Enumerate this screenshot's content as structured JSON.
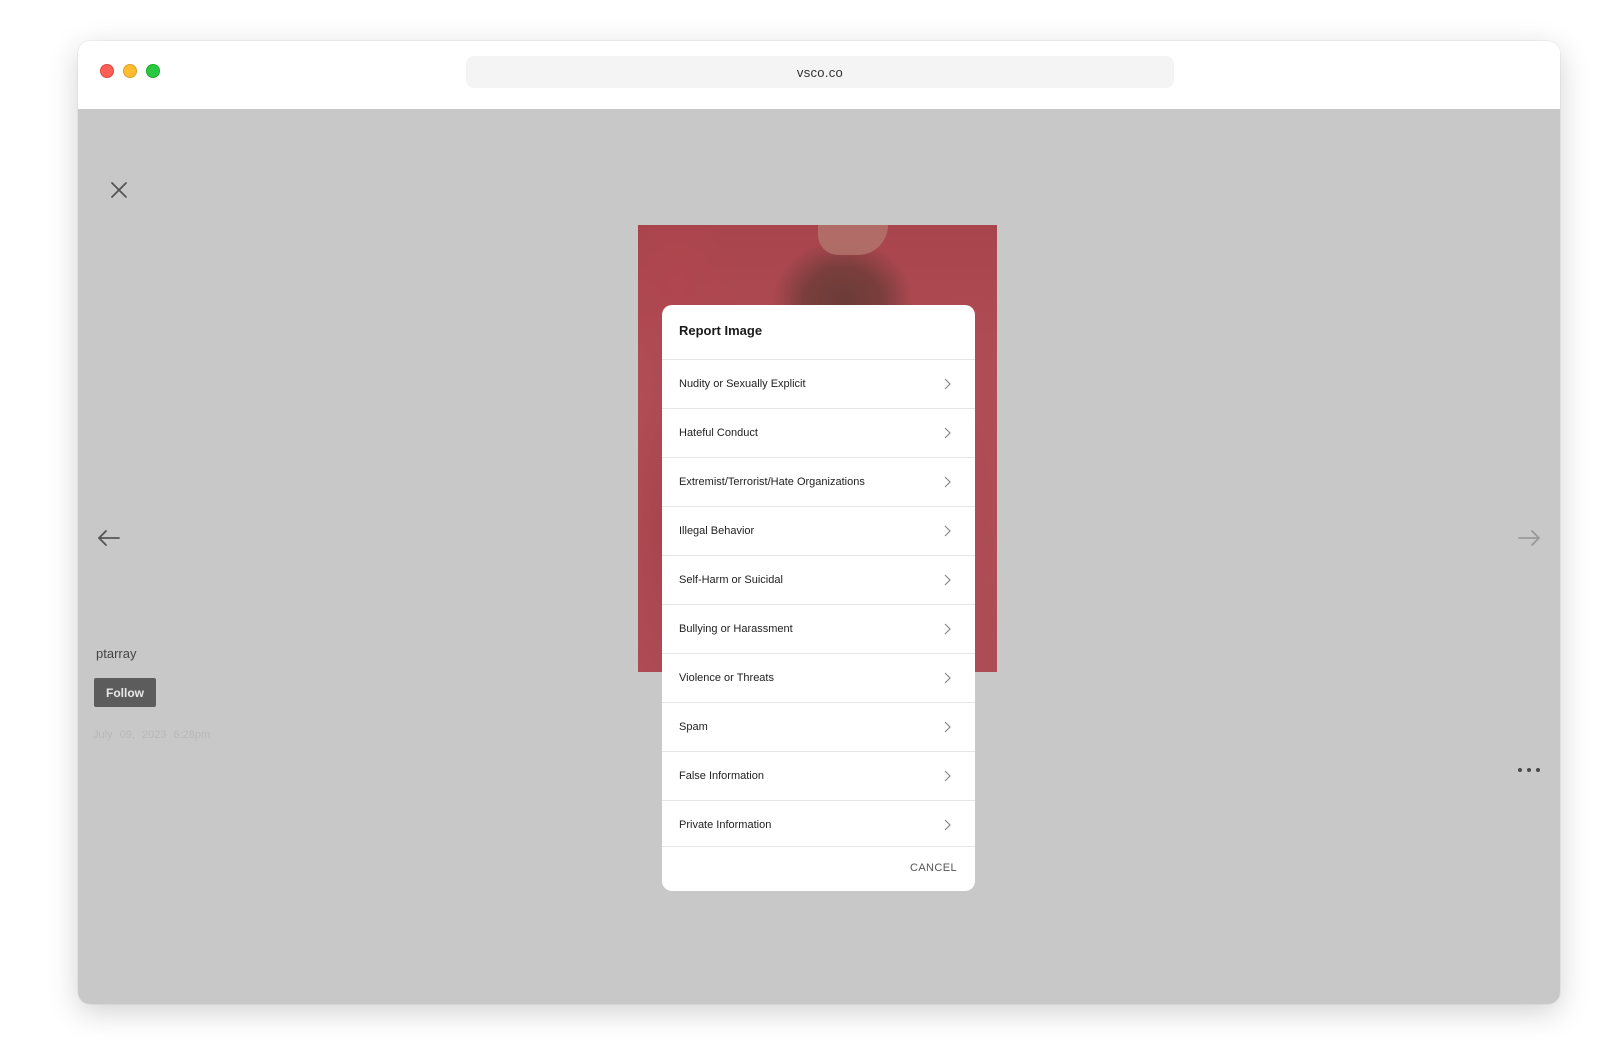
{
  "browser": {
    "url": "vsco.co"
  },
  "post": {
    "author": "ptarray",
    "follow_label": "Follow",
    "date": "July 09, 2023  6:28pm"
  },
  "icons": {
    "close": "close-icon",
    "prev": "arrow-left-icon",
    "next": "arrow-right-icon",
    "more": "more-horizontal-icon",
    "chevron": "chevron-right-icon"
  },
  "report_modal": {
    "title": "Report Image",
    "options": [
      {
        "label": "Nudity or Sexually Explicit"
      },
      {
        "label": "Hateful Conduct"
      },
      {
        "label": "Extremist/Terrorist/Hate Organizations"
      },
      {
        "label": "Illegal Behavior"
      },
      {
        "label": "Self-Harm or Suicidal"
      },
      {
        "label": "Bullying or Harassment"
      },
      {
        "label": "Violence or Threats"
      },
      {
        "label": "Spam"
      },
      {
        "label": "False Information"
      },
      {
        "label": "Private Information"
      }
    ],
    "cancel_label": "CANCEL"
  },
  "colors": {
    "overlay": "#c8c8c8",
    "follow_button": "#5c5c5c",
    "photo_tint": "#ae4c55"
  }
}
